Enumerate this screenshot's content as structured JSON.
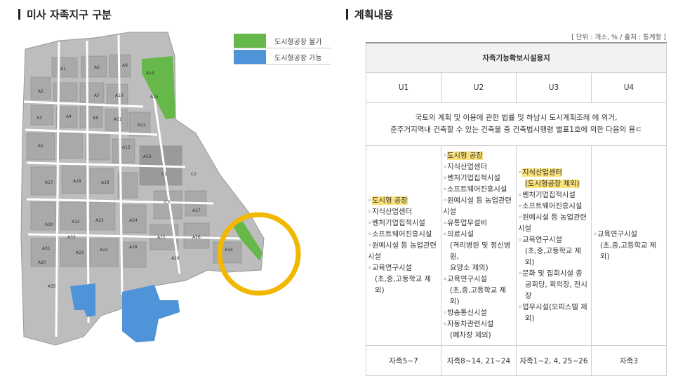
{
  "left_section": {
    "title": "미사 자족지구 구분"
  },
  "right_section": {
    "title": "계획내용"
  },
  "legend": [
    {
      "label": "도시형공장 불가",
      "color": "#66b84a"
    },
    {
      "label": "도시형공장 가능",
      "color": "#4f93d8"
    }
  ],
  "map_labels": [
    "A1",
    "A2",
    "A3",
    "A4",
    "A5",
    "A6",
    "A7",
    "A8",
    "A9",
    "A10",
    "A11",
    "A12",
    "A13",
    "A14",
    "A15",
    "A16",
    "A17",
    "A18",
    "A19",
    "A20",
    "A21",
    "A22",
    "A23",
    "A24",
    "A25",
    "A26",
    "A27",
    "A28",
    "A29",
    "A30",
    "A31",
    "A32",
    "A33",
    "A34",
    "A35",
    "C1",
    "C2",
    "C3"
  ],
  "source_note": "[ 단위 : 개소, % / 출처 : 통계청 ]",
  "table": {
    "header": "자족기능확보시설용지",
    "columns": [
      "U1",
      "U2",
      "U3",
      "U4"
    ],
    "description_line1": "국토의 계획 및 이용에 관한 법률 및 하남시 도시계획조례 에 의거,",
    "description_line2": "준주거지역내 건축할 수 있는 건축물 중 건축법시행령 별표1호에 의한 다음의 용ㄷ",
    "u1": {
      "highlight": "도시형 공장",
      "items": [
        "지식산업센터",
        "벤처기업집적시설",
        "소프트웨어진흥시설",
        "원예시설 등 농업관련",
        "시설",
        "교육연구시설"
      ],
      "sub": "(초,중,고등학교 제외)"
    },
    "u2": {
      "highlight": "도시형 공장",
      "items": [
        "지식산업센터",
        "벤처기업집적시설",
        "소프트웨어진흥시설",
        "원예시설 등 농업관련",
        "시설",
        "유통업무설비",
        "의료시설"
      ],
      "sub1": "(격리병원 및 정신병원,",
      "sub2": "요양소 제외)",
      "items2": [
        "교육연구시설"
      ],
      "sub3": "(초,중,고등학교 제외)",
      "items3": [
        "방송통신시설",
        "자동차관련시설"
      ],
      "sub4": "(폐차장 제외)"
    },
    "u3": {
      "highlight1": "지식산업센터",
      "highlight2": "(도시형공장 제외)",
      "items": [
        "벤처기업집적시설",
        "소프트웨어진흥시설",
        "원예시설 등 농업관련",
        "시설",
        "교육연구시설"
      ],
      "sub1": "(초,중,고등학교 제외)",
      "items2": [
        "문화 및 집회시설 중",
        "공회당, 회의장, 전시장",
        "업무시설(오피스텔 제",
        "외)"
      ]
    },
    "u4": {
      "item": "교육연구시설",
      "sub": "(초,중,고등학교 제외)"
    },
    "footer": [
      "자족5~7",
      "자족8~14, 21~24",
      "자족1~2, 4, 25~26",
      "자족3"
    ]
  }
}
